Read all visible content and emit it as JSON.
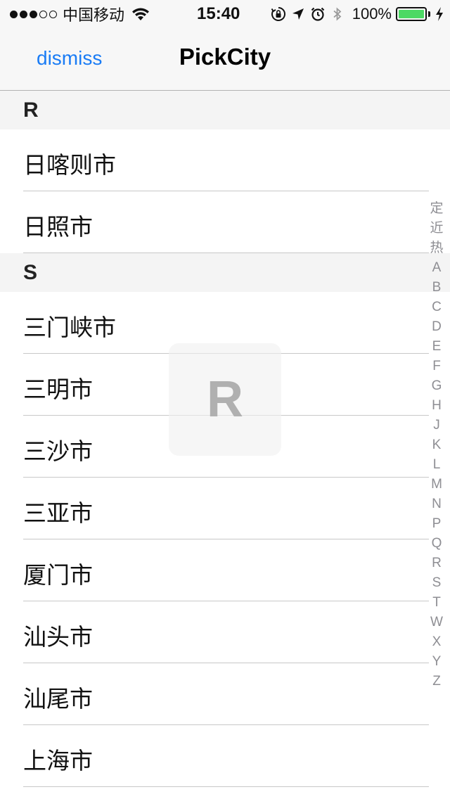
{
  "status_bar": {
    "signal_dots_filled": 3,
    "signal_dots_total": 5,
    "carrier": "中国移动",
    "time": "15:40",
    "battery_percent": "100%",
    "icons": [
      "wifi-icon",
      "rotation-lock-icon",
      "location-icon",
      "alarm-icon",
      "bluetooth-icon",
      "battery-icon",
      "charging-icon"
    ]
  },
  "nav": {
    "dismiss_label": "dismiss",
    "title": "PickCity"
  },
  "sections": [
    {
      "letter": "R",
      "cities": [
        "日喀则市",
        "日照市"
      ]
    },
    {
      "letter": "S",
      "cities": [
        "三门峡市",
        "三明市",
        "三沙市",
        "三亚市",
        "厦门市",
        "汕头市",
        "汕尾市",
        "上海市"
      ]
    }
  ],
  "index_bar": [
    "定",
    "近",
    "热",
    "A",
    "B",
    "C",
    "D",
    "E",
    "F",
    "G",
    "H",
    "J",
    "K",
    "L",
    "M",
    "N",
    "P",
    "Q",
    "R",
    "S",
    "T",
    "W",
    "X",
    "Y",
    "Z"
  ],
  "overlay_letter": "R",
  "colors": {
    "accent": "#1a7cf5",
    "battery": "#4cd964",
    "section_bg": "#f4f4f4",
    "index_text": "#8e8e93"
  }
}
